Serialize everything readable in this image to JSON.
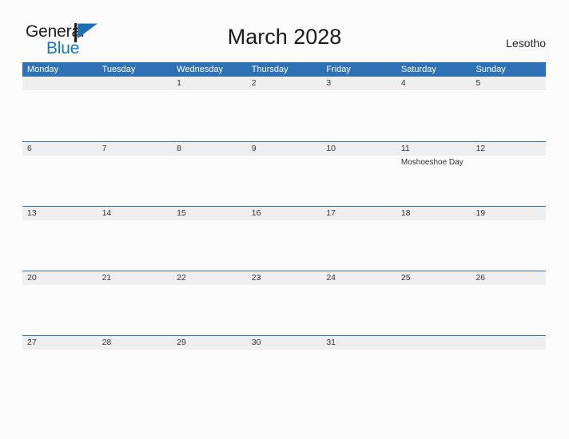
{
  "brand": {
    "name_line1": "General",
    "name_line2": "Blue",
    "flag_icon": "triangle-flag-icon",
    "color_dark": "#231f20",
    "color_blue": "#1279c8"
  },
  "header": {
    "title": "March 2028",
    "country": "Lesotho"
  },
  "theme": {
    "header_blue": "#2e72b5",
    "row_band_gray": "#efefef",
    "page_background": "#fcfcfc",
    "text_color": "#333333"
  },
  "calendar": {
    "month": "March",
    "year": "2028",
    "week_start": "Monday",
    "weekdays": [
      "Monday",
      "Tuesday",
      "Wednesday",
      "Thursday",
      "Friday",
      "Saturday",
      "Sunday"
    ],
    "weeks": [
      [
        {
          "day": "",
          "events": []
        },
        {
          "day": "",
          "events": []
        },
        {
          "day": "1",
          "events": []
        },
        {
          "day": "2",
          "events": []
        },
        {
          "day": "3",
          "events": []
        },
        {
          "day": "4",
          "events": []
        },
        {
          "day": "5",
          "events": []
        }
      ],
      [
        {
          "day": "6",
          "events": []
        },
        {
          "day": "7",
          "events": []
        },
        {
          "day": "8",
          "events": []
        },
        {
          "day": "9",
          "events": []
        },
        {
          "day": "10",
          "events": []
        },
        {
          "day": "11",
          "events": [
            "Moshoeshoe Day"
          ]
        },
        {
          "day": "12",
          "events": []
        }
      ],
      [
        {
          "day": "13",
          "events": []
        },
        {
          "day": "14",
          "events": []
        },
        {
          "day": "15",
          "events": []
        },
        {
          "day": "16",
          "events": []
        },
        {
          "day": "17",
          "events": []
        },
        {
          "day": "18",
          "events": []
        },
        {
          "day": "19",
          "events": []
        }
      ],
      [
        {
          "day": "20",
          "events": []
        },
        {
          "day": "21",
          "events": []
        },
        {
          "day": "22",
          "events": []
        },
        {
          "day": "23",
          "events": []
        },
        {
          "day": "24",
          "events": []
        },
        {
          "day": "25",
          "events": []
        },
        {
          "day": "26",
          "events": []
        }
      ],
      [
        {
          "day": "27",
          "events": []
        },
        {
          "day": "28",
          "events": []
        },
        {
          "day": "29",
          "events": []
        },
        {
          "day": "30",
          "events": []
        },
        {
          "day": "31",
          "events": []
        },
        {
          "day": "",
          "events": []
        },
        {
          "day": "",
          "events": []
        }
      ]
    ]
  }
}
